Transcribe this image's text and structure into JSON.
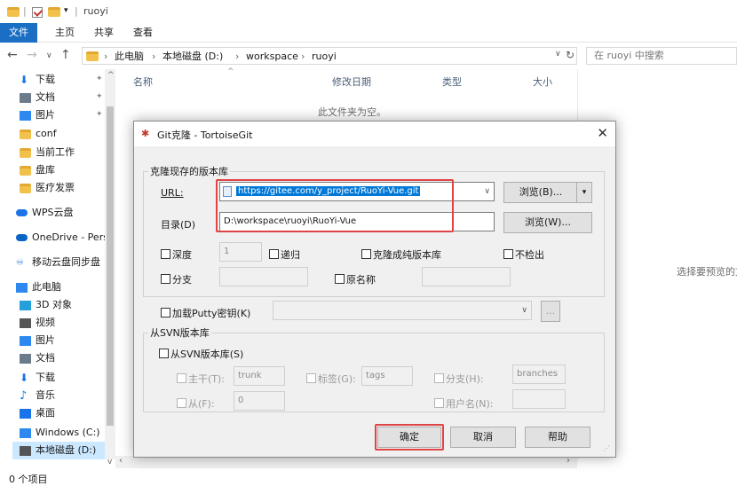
{
  "titlebar": {
    "path_name": "ruoyi",
    "qa_sep": "|"
  },
  "ribbon": {
    "tabs": [
      "文件",
      "主页",
      "共享",
      "查看"
    ]
  },
  "address": {
    "crumbs": [
      "此电脑",
      "本地磁盘 (D:)",
      "workspace",
      "ruoyi"
    ],
    "sep": "›",
    "search_placeholder": "在 ruoyi 中搜索"
  },
  "sidebar": {
    "items": [
      {
        "label": "下载",
        "icon": "download-icon",
        "color": "#1a73e8"
      },
      {
        "label": "文档",
        "icon": "document-icon",
        "color": "#6b7b8c"
      },
      {
        "label": "图片",
        "icon": "picture-icon",
        "color": "#2d89ef"
      },
      {
        "label": "conf",
        "icon": "folder-icon",
        "color": "#f2c14b"
      },
      {
        "label": "当前工作",
        "icon": "folder-icon",
        "color": "#f2c14b"
      },
      {
        "label": "盘库",
        "icon": "folder-icon",
        "color": "#f2c14b"
      },
      {
        "label": "医疗发票",
        "icon": "folder-icon",
        "color": "#f2c14b"
      },
      {
        "label": "WPS云盘",
        "icon": "cloud-icon",
        "color": "#1a73e8"
      },
      {
        "label": "OneDrive - Pers",
        "icon": "onedrive-icon",
        "color": "#0a64c8"
      },
      {
        "label": "移动云盘同步盘",
        "icon": "sync-icon",
        "color": "#1a73e8"
      },
      {
        "label": "此电脑",
        "icon": "computer-icon",
        "color": "#2d89ef"
      },
      {
        "label": "3D 对象",
        "icon": "cube-icon",
        "color": "#26a0da"
      },
      {
        "label": "视频",
        "icon": "video-icon",
        "color": "#555555"
      },
      {
        "label": "图片",
        "icon": "picture-icon",
        "color": "#2d89ef"
      },
      {
        "label": "文档",
        "icon": "document-icon",
        "color": "#6b7b8c"
      },
      {
        "label": "下载",
        "icon": "download-icon",
        "color": "#1a73e8"
      },
      {
        "label": "音乐",
        "icon": "music-icon",
        "color": "#1a73e8"
      },
      {
        "label": "桌面",
        "icon": "desktop-icon",
        "color": "#1a73e8"
      },
      {
        "label": "Windows (C:)",
        "icon": "drive-icon",
        "color": "#2d89ef"
      },
      {
        "label": "本地磁盘 (D:)",
        "icon": "drive-icon",
        "color": "#555555"
      }
    ]
  },
  "filelist": {
    "columns": [
      "名称",
      "修改日期",
      "类型",
      "大小"
    ],
    "empty_text": "此文件夹为空。",
    "preview_text": "选择要预览的文"
  },
  "status": {
    "item_count": "0 个项目"
  },
  "dialog": {
    "title": "Git克隆 - TortoiseGit",
    "clone_group": "克隆现存的版本库",
    "url_label": "URL:",
    "url_value": "https://gitee.com/y_project/RuoYi-Vue.git",
    "browse_label": "浏览(B)...",
    "dir_label": "目录(D)",
    "dir_value": "D:\\workspace\\ruoyi\\RuoYi-Vue",
    "browse_dir_label": "浏览(W)...",
    "depth_label": "深度",
    "depth_value": "1",
    "recursive_label": "递归",
    "bare_label": "克隆成纯版本库",
    "no_checkout_label": "不检出",
    "branch_label": "分支",
    "origin_label": "原名称",
    "putty_label": "加载Putty密钥(K)",
    "putty_browse": "...",
    "svn_group": "从SVN版本库",
    "from_svn_label": "从SVN版本库(S)",
    "trunk_label": "主干(T):",
    "trunk_value": "trunk",
    "tags_label": "标签(G):",
    "tags_value": "tags",
    "branches_label": "分支(H):",
    "branches_value": "branches",
    "from_label": "从(F):",
    "from_value": "0",
    "username_label": "用户名(N):",
    "ok_label": "确定",
    "cancel_label": "取消",
    "help_label": "帮助"
  },
  "colors": {
    "highlight": "#e04444",
    "accent": "#1a6fc4",
    "selection": "#0078d7"
  }
}
